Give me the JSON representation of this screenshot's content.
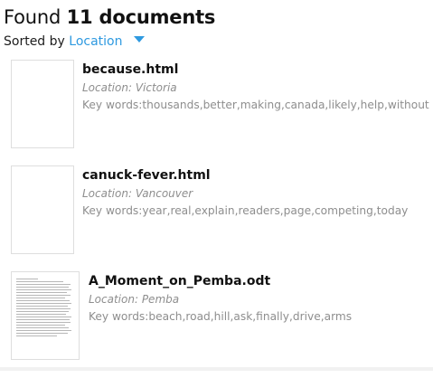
{
  "header": {
    "found_label": "Found",
    "count_label": "11 documents"
  },
  "sort": {
    "label": "Sorted by",
    "value": "Location"
  },
  "results": [
    {
      "title": "because.html",
      "location_label": "Location: Victoria",
      "keywords_label": "Key words:thousands,better,making,canada,likely,help,without"
    },
    {
      "title": "canuck-fever.html",
      "location_label": "Location: Vancouver",
      "keywords_label": "Key words:year,real,explain,readers,page,competing,today"
    },
    {
      "title": "A_Moment_on_Pemba.odt",
      "location_label": "Location: Pemba",
      "keywords_label": "Key words:beach,road,hill,ask,finally,drive,arms"
    }
  ],
  "icons": {
    "sort_caret": "chevron-down-icon"
  }
}
